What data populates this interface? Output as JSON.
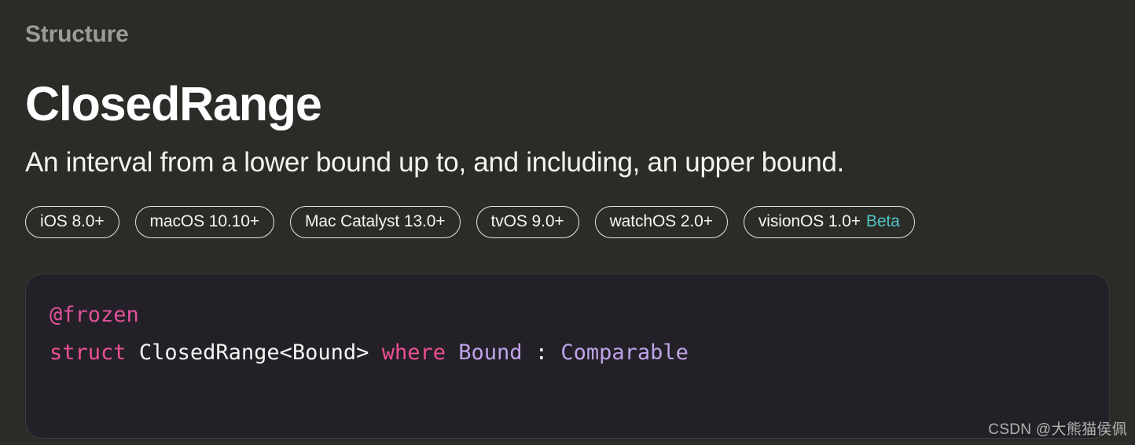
{
  "theme": {
    "background": "#2b2b28",
    "code_background": "#232127",
    "code_border": "#3b3a41",
    "eyebrow_color": "#9b9b98",
    "title_color": "#ffffff",
    "beta_color": "#4ec5c2",
    "keyword_color": "#ef4f92",
    "attribute_color": "#e1519a",
    "type_color": "#c0a3e8"
  },
  "header": {
    "eyebrow": "Structure",
    "title": "ClosedRange",
    "abstract": "An interval from a lower bound up to, and including, an upper bound."
  },
  "availability": {
    "platforms": [
      {
        "label": "iOS 8.0+",
        "beta": ""
      },
      {
        "label": "macOS 10.10+",
        "beta": ""
      },
      {
        "label": "Mac Catalyst 13.0+",
        "beta": ""
      },
      {
        "label": "tvOS 9.0+",
        "beta": ""
      },
      {
        "label": "watchOS 2.0+",
        "beta": ""
      },
      {
        "label": "visionOS 1.0+",
        "beta": "Beta"
      }
    ]
  },
  "declaration": {
    "line1": {
      "attribute": "@frozen"
    },
    "line2": {
      "keyword_struct": "struct",
      "name": "ClosedRange<Bound>",
      "keyword_where": "where",
      "generic_type": "Bound",
      "colon": ":",
      "constraint": "Comparable"
    }
  },
  "watermark": {
    "text": "CSDN @大熊猫侯佩"
  }
}
